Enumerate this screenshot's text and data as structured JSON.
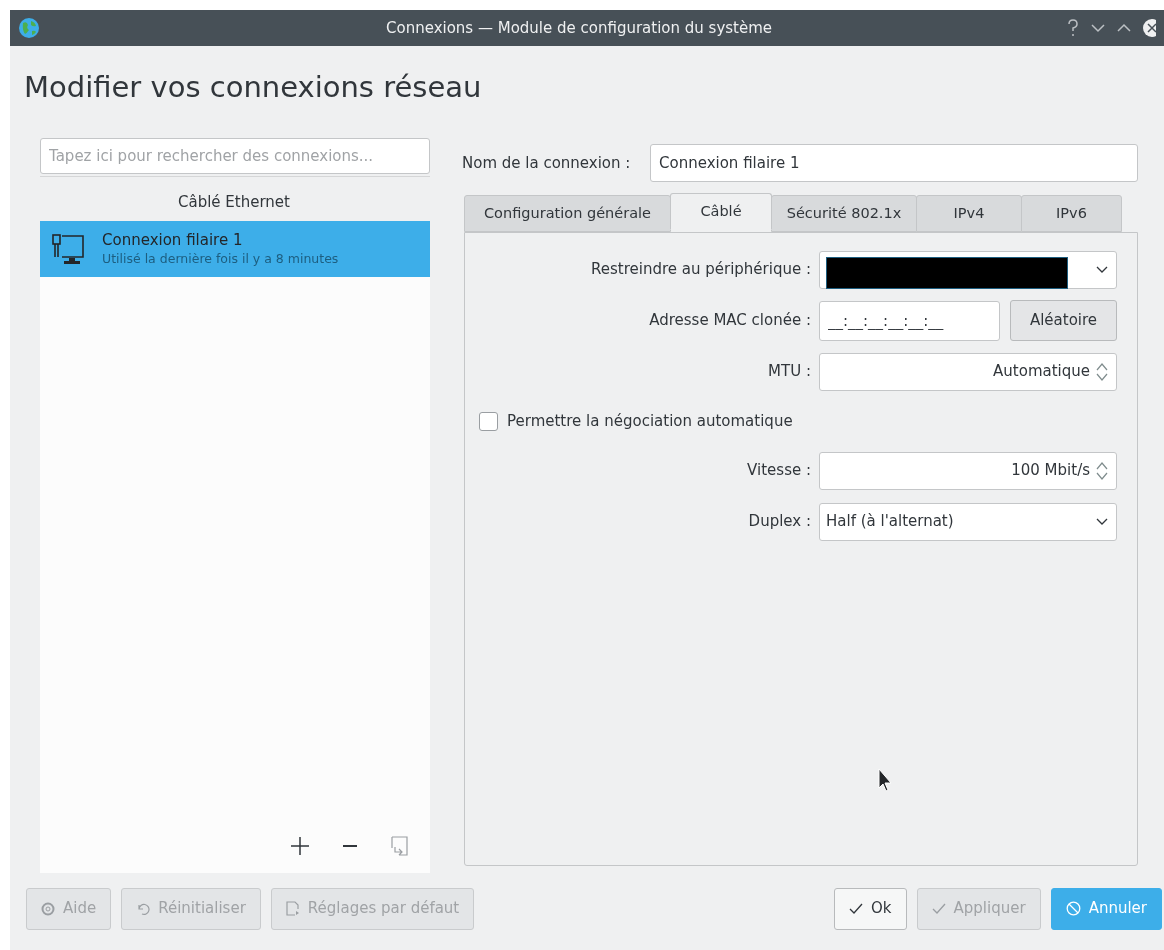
{
  "window": {
    "title": "Connexions — Module de configuration du système"
  },
  "heading": "Modifier vos connexions réseau",
  "search": {
    "placeholder": "Tapez ici pour rechercher des connexions..."
  },
  "group_label": "Câblé Ethernet",
  "connections": [
    {
      "name": "Connexion filaire 1",
      "detail": "Utilisé la dernière fois il y a 8 minutes",
      "selected": true
    }
  ],
  "connection_name": {
    "label": "Nom de la connexion :",
    "value": "Connexion filaire 1"
  },
  "tabs": [
    {
      "label": "Configuration générale",
      "selected": false
    },
    {
      "label": "Câblé",
      "selected": true
    },
    {
      "label": "Sécurité 802.1x",
      "selected": false
    },
    {
      "label": "IPv4",
      "selected": false
    },
    {
      "label": "IPv6",
      "selected": false
    }
  ],
  "fields": [
    {
      "kind": "combo",
      "label": "Restreindre au périphérique :",
      "redacted": true
    },
    {
      "kind": "mac",
      "label": "Adresse MAC clonée :",
      "value": "__:__:__:__:__:__",
      "button": "Aléatoire"
    },
    {
      "kind": "spin",
      "label": "MTU :",
      "value": "Automatique"
    },
    {
      "kind": "checkbox",
      "label": "Permettre la négociation automatique",
      "checked": false
    },
    {
      "kind": "spin",
      "label": "Vitesse :",
      "value": "100 Mbit/s"
    },
    {
      "kind": "combo",
      "label": "Duplex :",
      "value": "Half (à l'alternat)"
    }
  ],
  "buttons_left": [
    {
      "kind": "help",
      "label": "Aide",
      "disabled": true
    },
    {
      "kind": "reset",
      "label": "Réinitialiser",
      "disabled": true
    },
    {
      "kind": "defaults",
      "label": "Réglages par défaut",
      "disabled": true
    }
  ],
  "buttons_right": [
    {
      "kind": "ok",
      "label": "Ok",
      "disabled": false,
      "default": false
    },
    {
      "kind": "apply",
      "label": "Appliquer",
      "disabled": true,
      "default": false
    },
    {
      "kind": "cancel",
      "label": "Annuler",
      "disabled": false,
      "default": true
    }
  ]
}
